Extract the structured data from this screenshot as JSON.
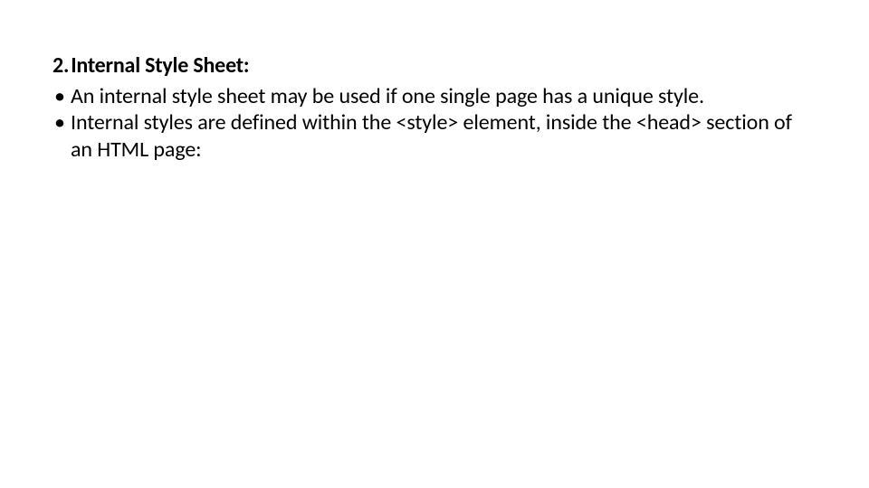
{
  "heading": {
    "number": "2.",
    "title": "Internal Style Sheet:"
  },
  "bullets": [
    "An internal style sheet may be used if one single page has a unique style.",
    "Internal styles are defined within the <style> element, inside the <head> section of an HTML page:"
  ]
}
